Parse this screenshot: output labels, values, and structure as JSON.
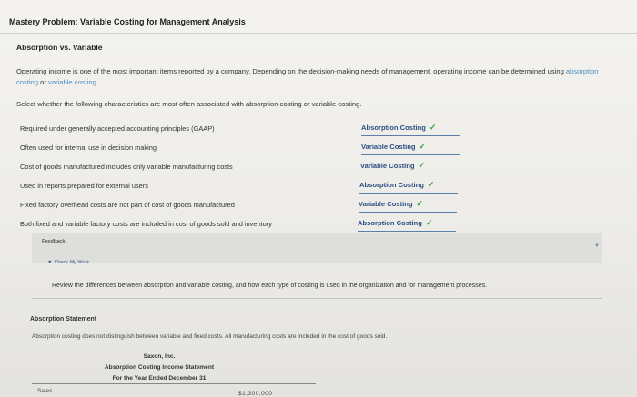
{
  "page": {
    "title": "Mastery Problem: Variable Costing for Management Analysis",
    "section_heading": "Absorption vs. Variable",
    "intro_text_1": "Operating income is one of the most important items reported by a company. Depending on the decision-making needs of management, operating income can be determined using ",
    "intro_link_1": "absorption costing",
    "intro_text_2": " or ",
    "intro_link_2": "variable costing",
    "intro_text_3": ".",
    "instruction": "Select whether the following characteristics are most often associated with absorption costing or variable costing."
  },
  "characteristics": [
    {
      "label": "Required under generally accepted accounting principles (GAAP)",
      "selection": "Absorption Costing",
      "correct": true
    },
    {
      "label": "Often used for internal use in decision making",
      "selection": "Variable Costing",
      "correct": true
    },
    {
      "label": "Cost of goods manufactured includes only variable manufacturing costs",
      "selection": "Variable Costing",
      "correct": true
    },
    {
      "label": "Used in reports prepared for external users",
      "selection": "Absorption Costing",
      "correct": true
    },
    {
      "label": "Fixed factory overhead costs are not part of cost of goods manufactured",
      "selection": "Variable Costing",
      "correct": true
    },
    {
      "label": "Both fixed and variable factory costs are included in cost of goods sold and inventory",
      "selection": "Absorption Costing",
      "correct": true
    }
  ],
  "check_symbol": "✓",
  "feedback": {
    "label": "Feedback",
    "check_my_work": "Check My Work",
    "review_text": "Review the differences between absorption and variable costing, and how each type of costing is used in the organization and for management processes."
  },
  "absorption_statement": {
    "heading": "Absorption Statement",
    "description": "Absorption costing does not distinguish between variable and fixed costs. All manufacturing costs are included in the cost of goods sold.",
    "company": "Saxon, Inc.",
    "statement_name": "Absorption Costing Income Statement",
    "period": "For the Year Ended December 31",
    "first_line_label": "Sales",
    "first_line_value": "$1,300,000"
  }
}
